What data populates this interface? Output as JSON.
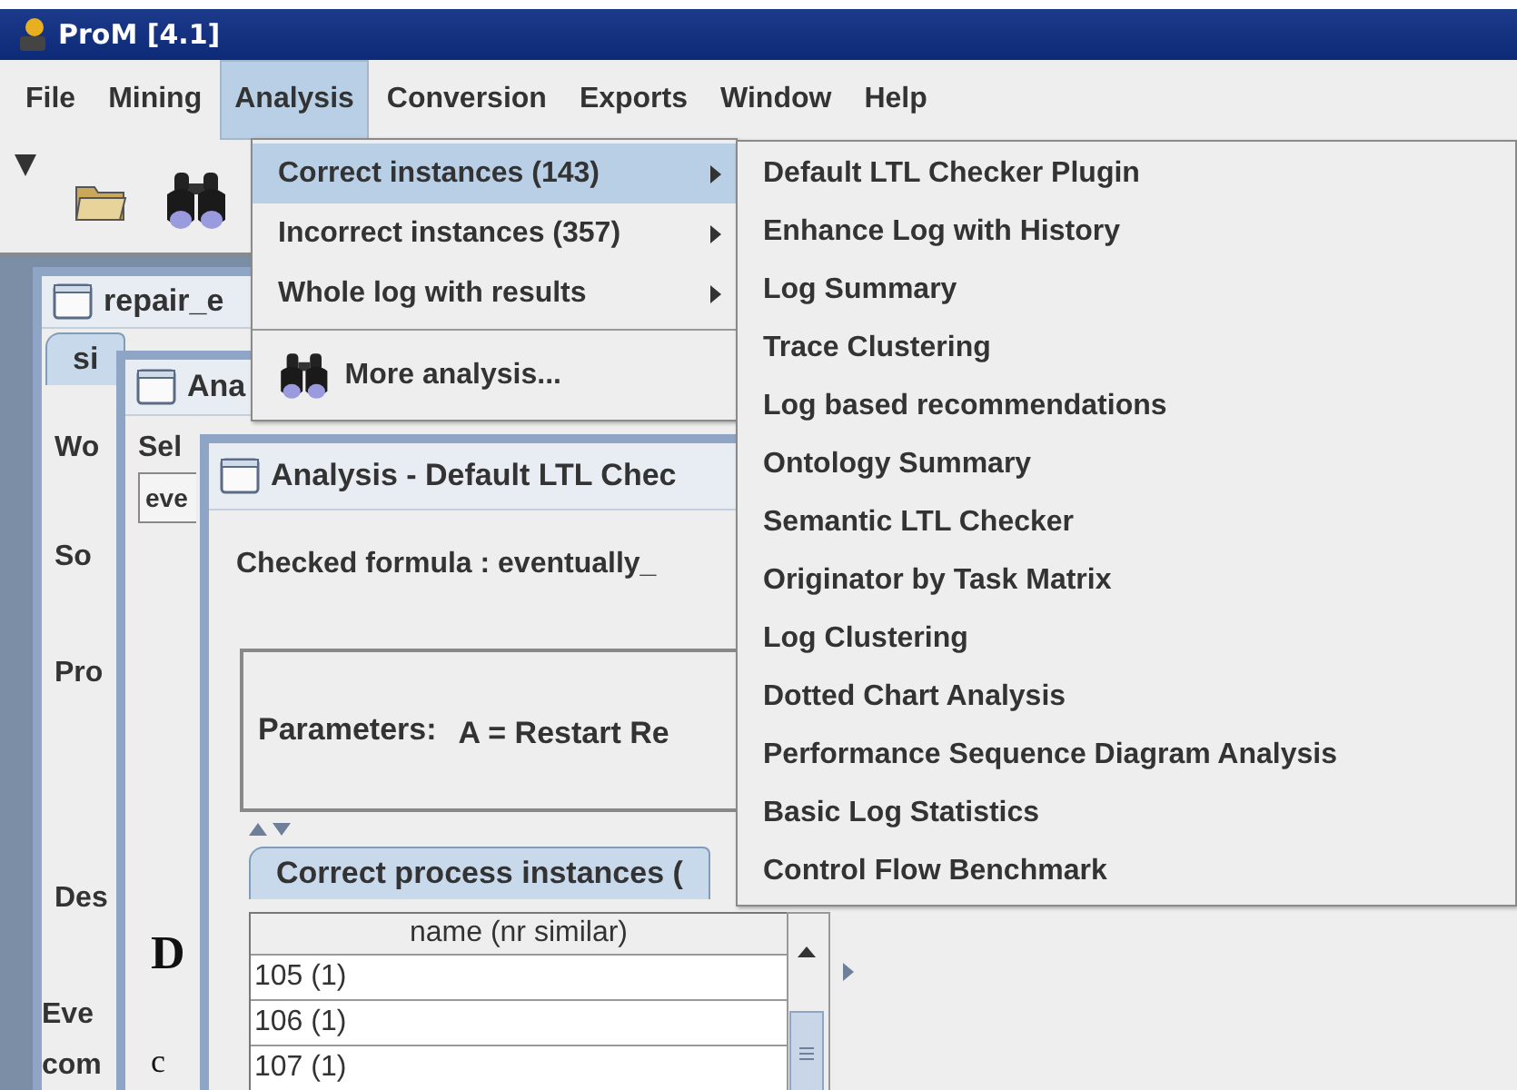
{
  "window": {
    "title": "ProM [4.1]"
  },
  "menu_bar": [
    {
      "label": "File",
      "selected": false
    },
    {
      "label": "Mining",
      "selected": false
    },
    {
      "label": "Analysis",
      "selected": true
    },
    {
      "label": "Conversion",
      "selected": false
    },
    {
      "label": "Exports",
      "selected": false
    },
    {
      "label": "Window",
      "selected": false
    },
    {
      "label": "Help",
      "selected": false
    }
  ],
  "analysis_menu": [
    {
      "kind": "submenu",
      "label": "Correct instances (143)",
      "selected": true
    },
    {
      "kind": "submenu",
      "label": "Incorrect instances (357)",
      "selected": false
    },
    {
      "kind": "submenu",
      "label": "Whole log with results",
      "selected": false
    },
    {
      "kind": "separator"
    },
    {
      "kind": "action",
      "label": "More analysis...",
      "selected": false
    }
  ],
  "submenu": [
    "Default LTL Checker Plugin",
    "Enhance Log with History",
    "Log Summary",
    "Trace Clustering",
    "Log based recommendations",
    "Ontology Summary",
    "Semantic LTL Checker",
    "Originator by Task Matrix",
    "Log Clustering",
    "Dotted Chart Analysis",
    "Performance Sequence Diagram Analysis",
    "Basic Log Statistics",
    "Control Flow Benchmark"
  ],
  "log_window": {
    "title": "repair_e",
    "tab": "si",
    "labels": [
      "Wo",
      "So",
      "Pro",
      "Des",
      "Eve",
      "com"
    ]
  },
  "analysis_window": {
    "title": "Ana",
    "label": "Sel",
    "field_value": "eve",
    "heading": "D",
    "text": "c"
  },
  "ltl_window": {
    "title": "Analysis - Default LTL Chec",
    "formula": "Checked formula : eventually_",
    "parameters_label": "Parameters:",
    "parameters_value": "A = Restart Re",
    "tab": "Correct process instances (",
    "table": {
      "columns": [
        "name (nr similar)"
      ],
      "rows": [
        "105 (1)",
        "106 (1)",
        "107 (1)"
      ]
    }
  }
}
